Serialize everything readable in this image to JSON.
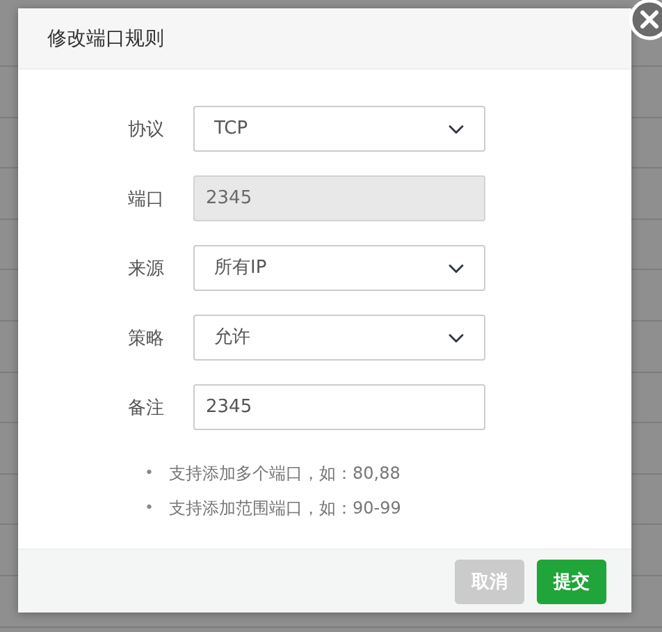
{
  "dialog": {
    "title": "修改端口规则",
    "fields": [
      {
        "label": "协议",
        "kind": "select",
        "value": "TCP",
        "disabled": false
      },
      {
        "label": "端口",
        "kind": "input",
        "value": "2345",
        "disabled": true
      },
      {
        "label": "来源",
        "kind": "select",
        "value": "所有IP",
        "disabled": false
      },
      {
        "label": "策略",
        "kind": "select",
        "value": "允许",
        "disabled": false
      },
      {
        "label": "备注",
        "kind": "input",
        "value": "2345",
        "disabled": false
      }
    ],
    "hints": [
      {
        "bullet": "•",
        "text": "支持添加多个端口，如：80,88"
      },
      {
        "bullet": "•",
        "text": "支持添加范围端口，如：90-99"
      }
    ],
    "buttons": [
      {
        "label": "取消",
        "kind": "cancel"
      },
      {
        "label": "提交",
        "kind": "submit"
      }
    ]
  }
}
